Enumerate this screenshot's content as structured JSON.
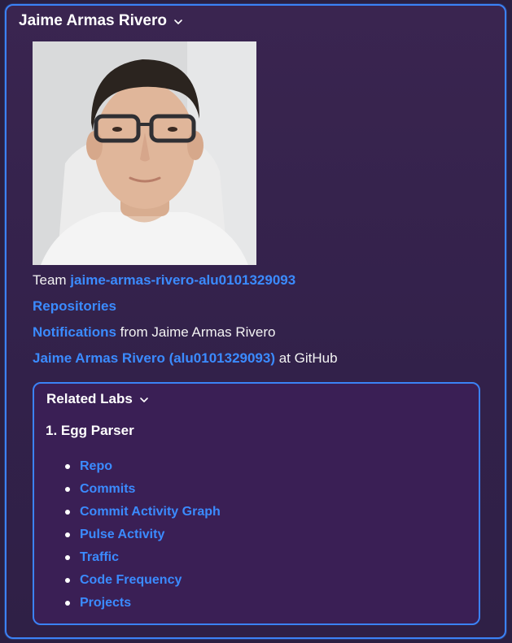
{
  "profile": {
    "name": "Jaime Armas Rivero",
    "team_prefix": "Team ",
    "team_link": "jaime-armas-rivero-alu0101329093",
    "repositories_link": "Repositories",
    "notifications_link": "Notifications",
    "notifications_suffix": " from Jaime Armas Rivero",
    "github_link": "Jaime Armas Rivero (alu0101329093)",
    "github_suffix": " at GitHub"
  },
  "related_labs": {
    "title": "Related Labs",
    "lab_number": "1.",
    "lab_name": "Egg Parser",
    "links": [
      "Repo",
      "Commits",
      "Commit Activity Graph",
      "Pulse Activity",
      "Traffic",
      "Code Frequency",
      "Projects"
    ]
  },
  "colors": {
    "accent": "#3b82f6",
    "link": "#3b8bff",
    "background": "#2a1f42"
  },
  "icons": {
    "expand": "chevron-down-icon"
  }
}
